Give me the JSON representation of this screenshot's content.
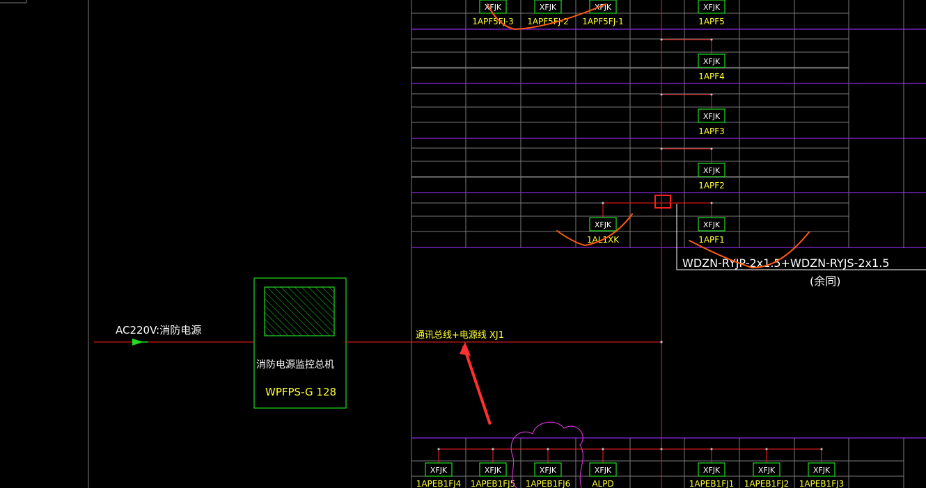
{
  "power_input": {
    "label": "AC220V:消防电源"
  },
  "host": {
    "title": "消防电源监控总机",
    "model": "WPFPS-G 128"
  },
  "bus": {
    "label": "通讯总线+电源线  XJ1"
  },
  "cable_note": {
    "spec": "WDZN-RYJP-2x1.5+WDZN-RYJS-2x1.5",
    "note": "(余同)"
  },
  "module_type": "XFJK",
  "top_rows": [
    {
      "modules": [
        {
          "tag": "1APF5FJ-3"
        },
        {
          "tag": "1APF5FJ-2"
        },
        {
          "tag": "1APF5FJ-1"
        },
        {
          "tag": "1APF5"
        }
      ]
    },
    {
      "modules": [
        {
          "tag": "1APF4"
        }
      ]
    },
    {
      "modules": [
        {
          "tag": "1APF3"
        }
      ]
    },
    {
      "modules": [
        {
          "tag": "1APF2"
        }
      ]
    },
    {
      "modules": [
        {
          "tag": "1AL1XK"
        },
        {
          "tag": "1APF1"
        }
      ]
    }
  ],
  "bottom_row": {
    "modules": [
      {
        "tag": "1APEB1FJ4"
      },
      {
        "tag": "1APEB1FJ5"
      },
      {
        "tag": "1APEB1FJ6"
      },
      {
        "tag": "ALPD"
      },
      {
        "tag": "1APEB1FJ1"
      },
      {
        "tag": "1APEB1FJ2"
      },
      {
        "tag": "1APEB1FJ3"
      }
    ]
  },
  "colors": {
    "background": "#000000",
    "wire": "#ff2020",
    "module_border": "#22dd22",
    "grid": "#7a7a7a",
    "floor_line": "#8a2be2",
    "annotation": "#ff5a10",
    "cloud": "#cc33cc",
    "label": "#ffff33"
  }
}
